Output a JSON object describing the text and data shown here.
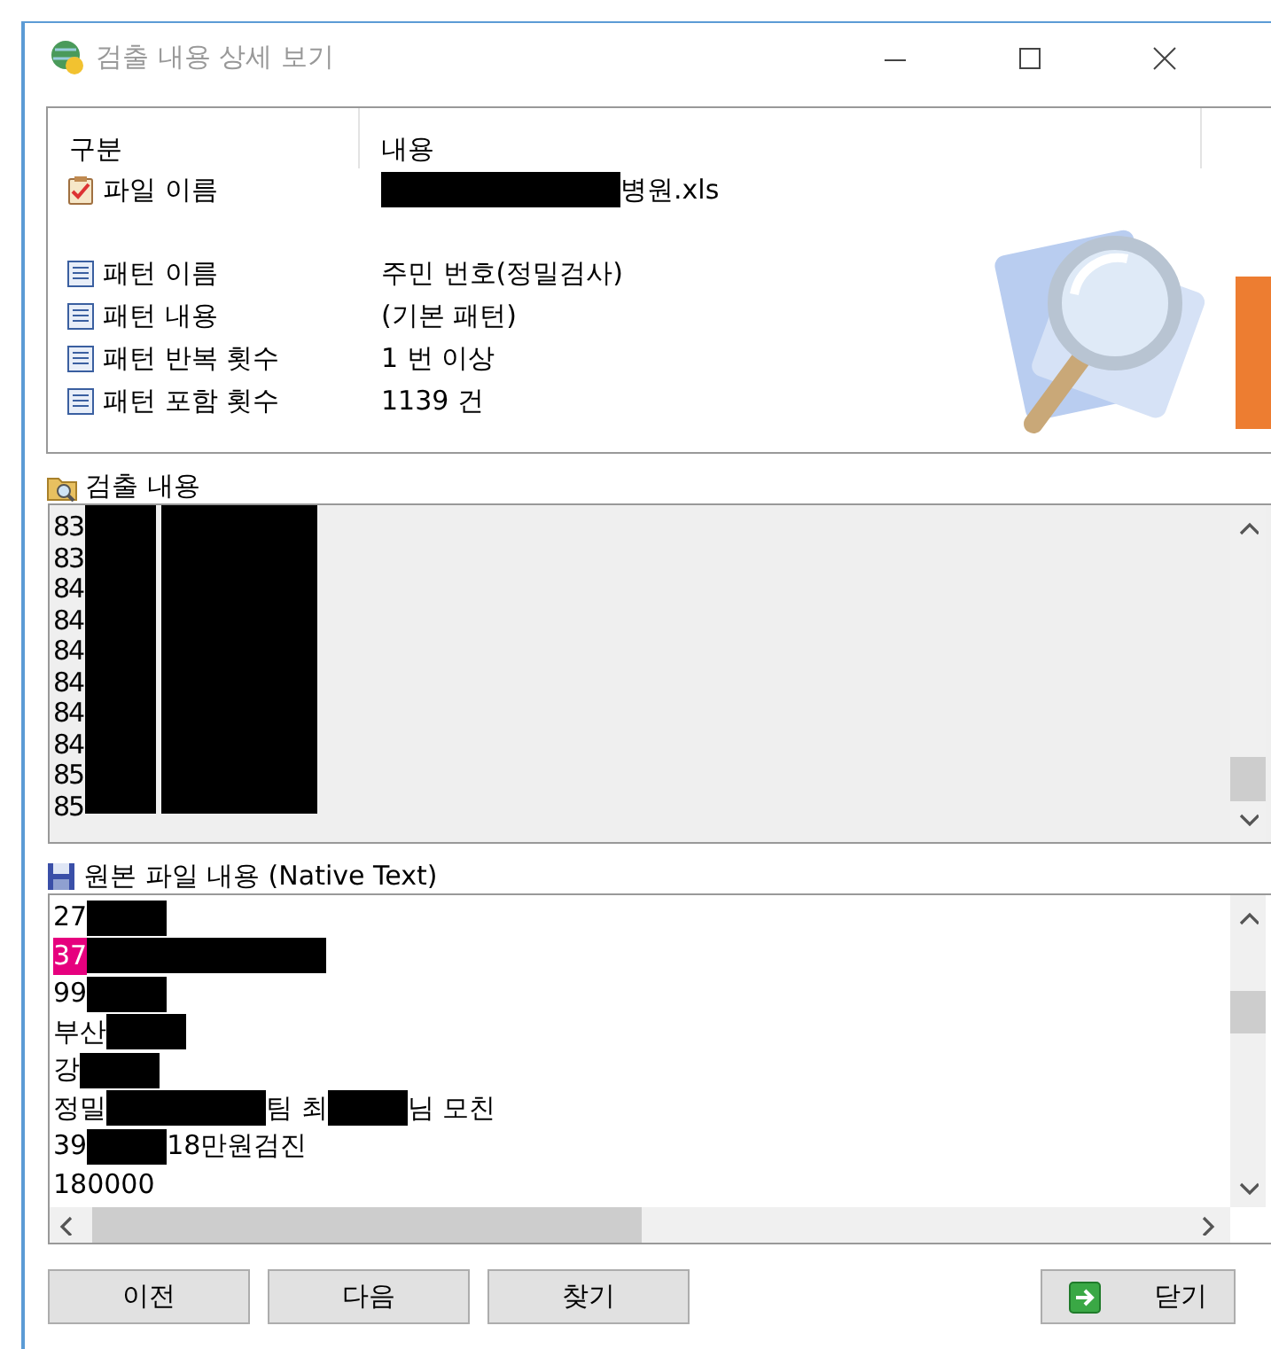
{
  "window": {
    "title": "검출 내용 상세 보기",
    "active": false
  },
  "summary": {
    "columns": [
      "구분",
      "내용"
    ],
    "rows": [
      {
        "kind": "file",
        "label": "파일 이름",
        "value": [
          {
            "kind": "redaction"
          },
          {
            "kind": "redaction"
          },
          {
            "kind": "redaction"
          },
          {
            "kind": "text",
            "text": "병원.xls"
          }
        ]
      },
      {
        "kind": "pattern",
        "label": "패턴 이름",
        "value": [
          {
            "kind": "text",
            "text": "주민 번호(정밀검사)"
          }
        ]
      },
      {
        "kind": "pattern",
        "label": "패턴 내용",
        "value": [
          {
            "kind": "text",
            "text": "(기본 패턴)"
          }
        ]
      },
      {
        "kind": "pattern",
        "label": "패턴 반복 횟수",
        "value": [
          {
            "kind": "text",
            "text": "1 번 이상"
          }
        ]
      },
      {
        "kind": "pattern",
        "label": "패턴 포함 횟수",
        "value": [
          {
            "kind": "text",
            "text": "1139 건"
          }
        ]
      }
    ]
  },
  "detected": {
    "title": "검출 내용",
    "redacted": true,
    "items": [
      "83",
      "83",
      "84",
      "84",
      "84",
      "84",
      "84",
      "84",
      "85",
      "85"
    ]
  },
  "native": {
    "title": "원본 파일 내용 (Native Text)",
    "lines": [
      [
        {
          "kind": "text",
          "text": "27"
        },
        {
          "kind": "redaction"
        }
      ],
      [
        {
          "kind": "text",
          "text": "37",
          "highlighted": true
        },
        {
          "kind": "redaction"
        },
        {
          "kind": "redaction"
        },
        {
          "kind": "redaction"
        }
      ],
      [
        {
          "kind": "text",
          "text": "99"
        },
        {
          "kind": "redaction"
        }
      ],
      [
        {
          "kind": "text",
          "text": "부산"
        },
        {
          "kind": "redaction"
        }
      ],
      [
        {
          "kind": "text",
          "text": "강"
        },
        {
          "kind": "redaction"
        }
      ],
      [
        {
          "kind": "text",
          "text": "정밀"
        },
        {
          "kind": "redaction"
        },
        {
          "kind": "redaction"
        },
        {
          "kind": "text",
          "text": "팀 최"
        },
        {
          "kind": "redaction"
        },
        {
          "kind": "text",
          "text": "님 모친"
        }
      ],
      [
        {
          "kind": "text",
          "text": "39"
        },
        {
          "kind": "redaction"
        },
        {
          "kind": "text",
          "text": " 18만원검진"
        }
      ],
      [
        {
          "kind": "text",
          "text": "180000"
        }
      ]
    ]
  },
  "buttons": [
    {
      "label": "이전",
      "kind": "plain"
    },
    {
      "label": "다음",
      "kind": "plain"
    },
    {
      "label": "찾기",
      "kind": "plain"
    },
    {
      "label": "닫기",
      "kind": "close"
    }
  ]
}
